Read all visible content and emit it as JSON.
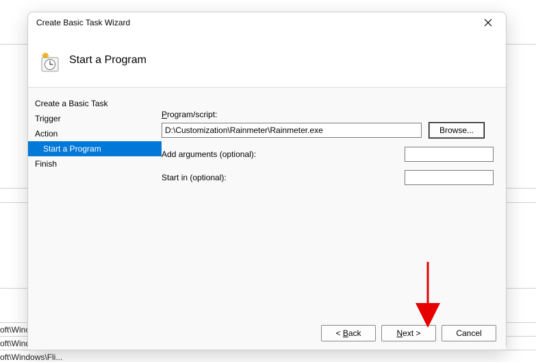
{
  "window": {
    "title": "Create Basic Task Wizard"
  },
  "header": {
    "heading": "Start a Program"
  },
  "sidebar": {
    "items": [
      {
        "label": "Create a Basic Task"
      },
      {
        "label": "Trigger"
      },
      {
        "label": "Action"
      },
      {
        "label": "Start a Program"
      },
      {
        "label": "Finish"
      }
    ]
  },
  "form": {
    "program_label_pre": "P",
    "program_label_post": "rogram/script:",
    "program_value": "D:\\Customization\\Rainmeter\\Rainmeter.exe",
    "browse_label": "Browse...",
    "browse_underline": "r",
    "add_args_pre": "A",
    "add_args_post": "dd arguments (optional):",
    "add_args_value": "",
    "startin_label": "Start in (optional):",
    "startin_underline": "t",
    "startin_value": ""
  },
  "footer": {
    "back_pre": "< ",
    "back_ul": "B",
    "back_post": "ack",
    "next_pre": "",
    "next_ul": "N",
    "next_post": "ext >",
    "cancel": "Cancel"
  },
  "bgfrags": {
    "a": "oft\\Winc",
    "b": "oft\\Windows\\U...",
    "c": "oft\\Windows\\Fli..."
  }
}
